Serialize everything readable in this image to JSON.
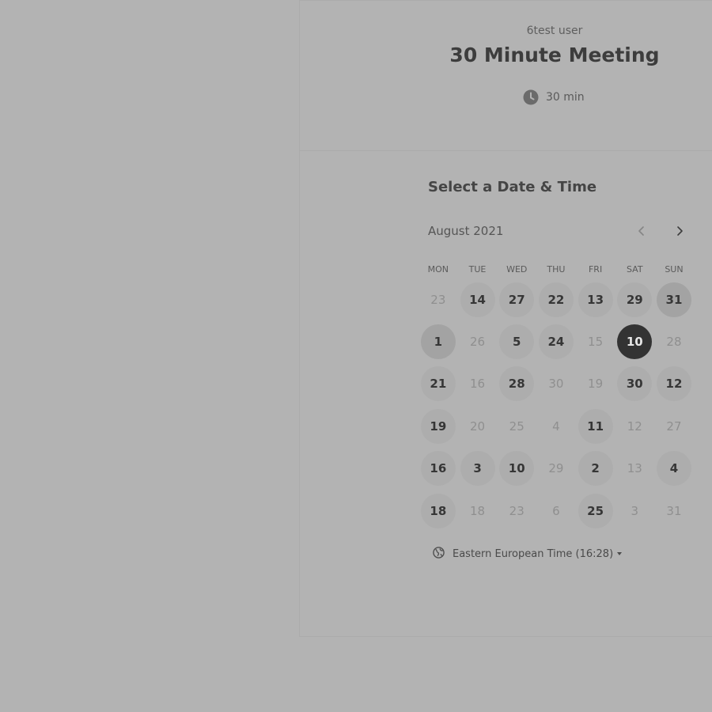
{
  "header": {
    "host_name": "6test user",
    "event_title": "30 Minute Meeting",
    "duration": "30 min",
    "duration_icon": "clock-icon"
  },
  "calendar": {
    "section_title": "Select a Date & Time",
    "month_label": "August 2021",
    "prev_icon": "chevron-left-icon",
    "next_icon": "chevron-right-icon",
    "weekdays": [
      "MON",
      "TUE",
      "WED",
      "THU",
      "FRI",
      "SAT",
      "SUN"
    ],
    "days": [
      {
        "label": "23",
        "available": false
      },
      {
        "label": "14",
        "available": true
      },
      {
        "label": "27",
        "available": true
      },
      {
        "label": "22",
        "available": true
      },
      {
        "label": "13",
        "available": true
      },
      {
        "label": "29",
        "available": true
      },
      {
        "label": "31",
        "available": true,
        "highlight": true
      },
      {
        "label": "1",
        "available": true,
        "highlight": true
      },
      {
        "label": "26",
        "available": false
      },
      {
        "label": "5",
        "available": true
      },
      {
        "label": "24",
        "available": true
      },
      {
        "label": "15",
        "available": false
      },
      {
        "label": "10",
        "available": true,
        "selected": true
      },
      {
        "label": "28",
        "available": false
      },
      {
        "label": "21",
        "available": true
      },
      {
        "label": "16",
        "available": false
      },
      {
        "label": "28",
        "available": true
      },
      {
        "label": "30",
        "available": false
      },
      {
        "label": "19",
        "available": false
      },
      {
        "label": "30",
        "available": true
      },
      {
        "label": "12",
        "available": true
      },
      {
        "label": "19",
        "available": true
      },
      {
        "label": "20",
        "available": false
      },
      {
        "label": "25",
        "available": false
      },
      {
        "label": "4",
        "available": false
      },
      {
        "label": "11",
        "available": true
      },
      {
        "label": "12",
        "available": false
      },
      {
        "label": "27",
        "available": false
      },
      {
        "label": "16",
        "available": true
      },
      {
        "label": "3",
        "available": true
      },
      {
        "label": "10",
        "available": true
      },
      {
        "label": "29",
        "available": false
      },
      {
        "label": "2",
        "available": true
      },
      {
        "label": "13",
        "available": false
      },
      {
        "label": "4",
        "available": true
      },
      {
        "label": "18",
        "available": true
      },
      {
        "label": "18",
        "available": false
      },
      {
        "label": "23",
        "available": false
      },
      {
        "label": "6",
        "available": false
      },
      {
        "label": "25",
        "available": true
      },
      {
        "label": "3",
        "available": false
      },
      {
        "label": "31",
        "available": false
      }
    ]
  },
  "timezone": {
    "label": "Eastern European Time (16:28)",
    "icon": "globe-icon"
  }
}
